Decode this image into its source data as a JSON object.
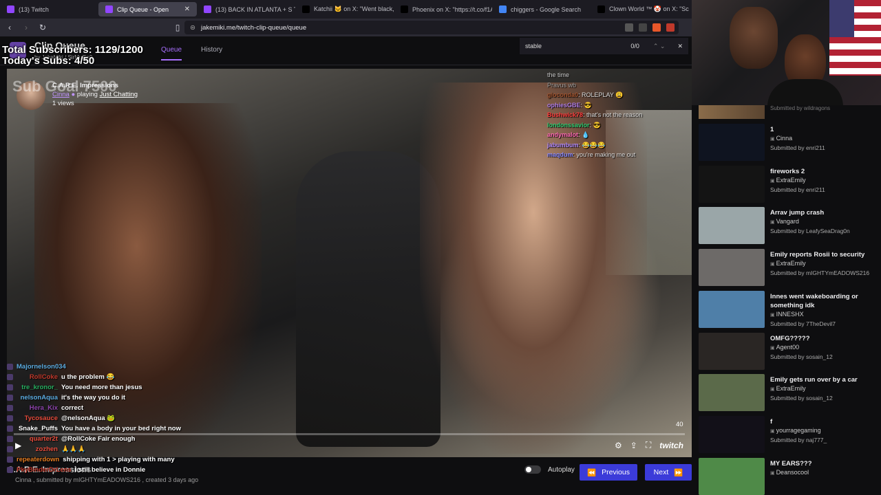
{
  "browser": {
    "tabs": [
      {
        "label": "(13) Twitch",
        "color": "#9146ff",
        "active": false
      },
      {
        "label": "Clip Queue - Open",
        "color": "#9146ff",
        "active": true
      },
      {
        "label": "(13) BACK IN ATLANTA + S TIE",
        "color": "#9146ff",
        "active": false
      },
      {
        "label": "Katchii 🐱 on X: \"Went black, ...\"",
        "color": "#000000",
        "active": false
      },
      {
        "label": "Phoenix on X: \"https://t.co/f1A",
        "color": "#000000",
        "active": false
      },
      {
        "label": "chiggers - Google Search",
        "color": "#4285f4",
        "active": false
      },
      {
        "label": "Clown World ™ 🤡 on X: \"Scan",
        "color": "#000000",
        "active": false
      }
    ],
    "url": "jakemiki.me/twitch-clip-queue/queue"
  },
  "find": {
    "query": "stable",
    "count": "0/0"
  },
  "app": {
    "title": "Clip Queue",
    "by": "by JakeMiki / SirMuffin9",
    "nav": [
      "Queue",
      "History"
    ]
  },
  "overlay": {
    "total_subs": "Total Subscribers: 1129/1200",
    "today_subs": "Today's Subs: 4/50",
    "ghost_goal": "Sub Goal 7500"
  },
  "clip": {
    "title": "C.A.R.E. Impressions",
    "channel": "Cinna",
    "playing_prefix": "playing",
    "category": "Just Chatting",
    "views": "1 views",
    "time": "40"
  },
  "top_chat": [
    {
      "user": "",
      "msg": "the time",
      "color": "#cccccc"
    },
    {
      "user": "",
      "msg": "Pravus wb",
      "color": "#9d9d9d"
    },
    {
      "user": "gioconda0",
      "msg": "ROLEPLAY 😩",
      "color": "#a0522d"
    },
    {
      "user": "ophiesGBE",
      "msg": "😎",
      "color": "#b27fe6"
    },
    {
      "user": "Bushwick78",
      "msg": "that's not the reason",
      "color": "#ff3b3b"
    },
    {
      "user": "londonssavior",
      "msg": "😎",
      "color": "#2ecc71"
    },
    {
      "user": "andymalot",
      "msg": "💧",
      "color": "#ff69b4"
    },
    {
      "user": "jabumbum",
      "msg": "😂😂😂",
      "color": "#b58cff"
    },
    {
      "user": "maqdum",
      "msg": "you're making me out",
      "color": "#8a8aff"
    }
  ],
  "chat": [
    {
      "user": "Majornelson034",
      "msg": "",
      "color": "#5dade2"
    },
    {
      "user": "RollCoke",
      "msg": "u the problem 😂",
      "color": "#c0392b"
    },
    {
      "user": "tre_kronor_",
      "msg": "You need more than jesus",
      "color": "#27ae60"
    },
    {
      "user": "nelsonAqua",
      "msg": "it's the way you do it",
      "color": "#5dade2"
    },
    {
      "user": "Hera_Kix",
      "msg": "correct",
      "color": "#8e44ad"
    },
    {
      "user": "Tycosauce",
      "msg": "@nelsonAqua 🐸",
      "color": "#e74c3c"
    },
    {
      "user": "Snake_Puffs",
      "msg": "You have a body in your bed right now",
      "color": "#ffffff"
    },
    {
      "user": "quarter2t",
      "msg": "@RollCoke Fair enough",
      "color": "#e74c3c"
    },
    {
      "user": "zozhen",
      "msg": "🙏🙏🙏",
      "color": "#e74c3c"
    },
    {
      "user": "repeaterdown",
      "msg": "shipping with 1 > playing with many",
      "color": "#e67e22"
    },
    {
      "user": "PkyBinderDrLens",
      "msg": "I still believe in Donnie",
      "color": "#c0392b"
    }
  ],
  "footer": {
    "title": "C.A.R.E. Impressions",
    "meta": "Cinna , submitted by mIGHTYmEADOWS216 , created 3 days ago",
    "autoplay": "Autoplay",
    "previous": "Previous",
    "next": "Next"
  },
  "queue": {
    "partial_text": "Submitted by wildragons",
    "items": [
      {
        "title": "1",
        "channel": "Cinna",
        "submitted": "Submitted by enri211",
        "thumb": "#0f1420"
      },
      {
        "title": "fireworks 2",
        "channel": "ExtraEmily",
        "submitted": "Submitted by enri211",
        "thumb": "#141414"
      },
      {
        "title": "Arrav jump crash",
        "channel": "Vangard",
        "submitted": "Submitted by LeafySeaDrag0n",
        "thumb": "#9aa6a8"
      },
      {
        "title": "Emily reports Rosii to security",
        "channel": "ExtraEmily",
        "submitted": "Submitted by mIGHTYmEADOWS216",
        "thumb": "#6d6a68"
      },
      {
        "title": "Innes went wakeboarding or something idk",
        "channel": "INNESHX",
        "submitted": "Submitted by 7TheDevil7",
        "thumb": "#4f7fa8"
      },
      {
        "title": "OMFG?????",
        "channel": "Agent00",
        "submitted": "Submitted by sosain_12",
        "thumb": "#2a2624"
      },
      {
        "title": "Emily gets run over by a car",
        "channel": "ExtraEmily",
        "submitted": "Submitted by sosain_12",
        "thumb": "#5b6a4a"
      },
      {
        "title": "f",
        "channel": "yourragegaming",
        "submitted": "Submitted by naj777_",
        "thumb": "#121018"
      },
      {
        "title": "MY EARS???",
        "channel": "Deansocool",
        "submitted": "",
        "thumb": "#4f8a48"
      }
    ]
  }
}
